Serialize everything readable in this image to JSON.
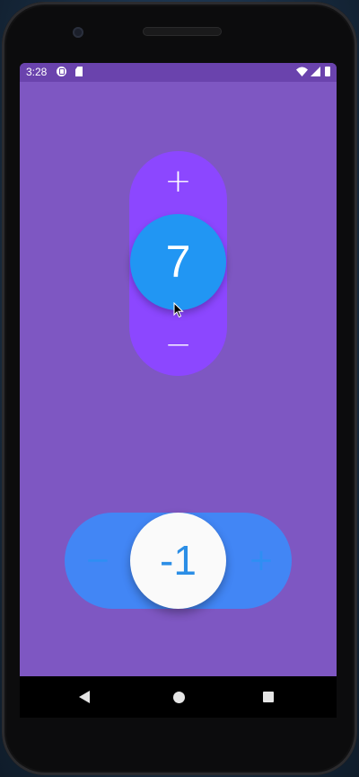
{
  "status_bar": {
    "time": "3:28",
    "icons": [
      "app-notification-icon",
      "sd-card-icon",
      "wifi-icon",
      "signal-icon",
      "battery-icon"
    ]
  },
  "vertical_counter": {
    "increment_label": "+",
    "decrement_label": "−",
    "value": "7"
  },
  "horizontal_counter": {
    "decrement_label": "−",
    "increment_label": "+",
    "value": "-1"
  },
  "nav_bar": {
    "icons": [
      "back-icon",
      "home-icon",
      "recents-icon"
    ]
  },
  "colors": {
    "screen_background": "#7e57c2",
    "status_bar": "#6a43ad",
    "vertical_pill": "#8c47ff",
    "vertical_knob": "#2196f3",
    "horizontal_pill": "#4286f5",
    "horizontal_knob": "#fafafa",
    "horizontal_text": "#2b8ee6"
  }
}
